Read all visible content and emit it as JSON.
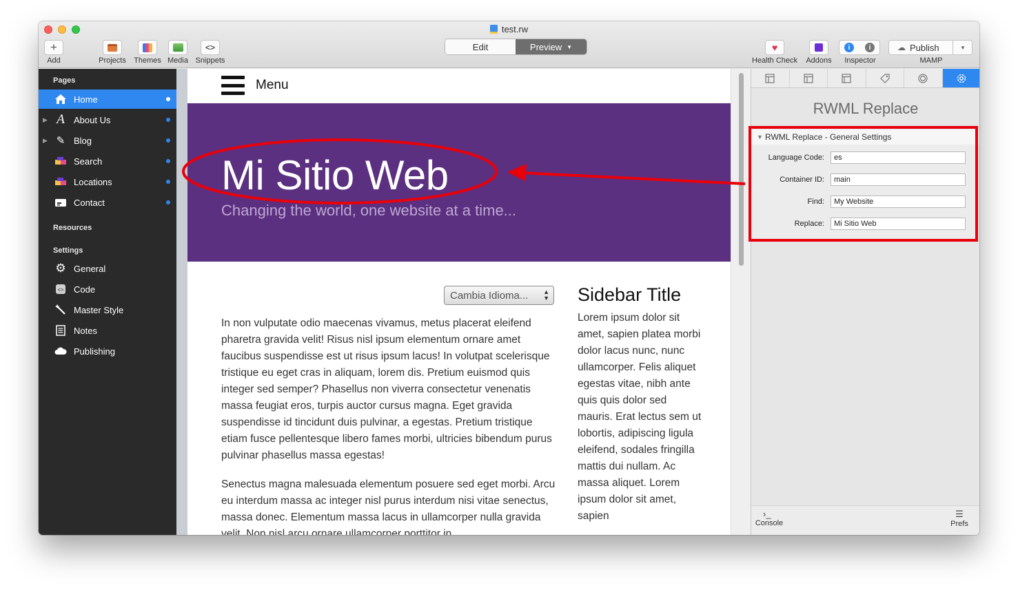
{
  "window": {
    "title": "test.rw"
  },
  "toolbar": {
    "add": "Add",
    "projects": "Projects",
    "themes": "Themes",
    "media": "Media",
    "snippets": "Snippets",
    "edit": "Edit",
    "preview": "Preview",
    "health_check": "Health Check",
    "addons": "Addons",
    "inspector": "Inspector",
    "publish": "Publish",
    "publish_target": "MAMP"
  },
  "sidebar": {
    "pages_header": "Pages",
    "pages": [
      {
        "label": "Home",
        "icon": "home-icon",
        "active": true
      },
      {
        "label": "About Us",
        "icon": "styled-text-icon"
      },
      {
        "label": "Blog",
        "icon": "pencil-icon"
      },
      {
        "label": "Search",
        "icon": "blocks-icon"
      },
      {
        "label": "Locations",
        "icon": "blocks-icon"
      },
      {
        "label": "Contact",
        "icon": "contact-card-icon"
      }
    ],
    "resources_header": "Resources",
    "settings_header": "Settings",
    "settings": [
      {
        "label": "General",
        "icon": "gear-icon"
      },
      {
        "label": "Code",
        "icon": "code-icon"
      },
      {
        "label": "Master Style",
        "icon": "wand-icon"
      },
      {
        "label": "Notes",
        "icon": "notes-icon"
      },
      {
        "label": "Publishing",
        "icon": "cloud-icon"
      }
    ]
  },
  "site": {
    "menu": "Menu",
    "title": "Mi Sitio Web",
    "subtitle": "Changing the world, one website at a time...",
    "language_select": "Cambia Idioma...",
    "paragraph1": "In non vulputate odio maecenas vivamus, metus placerat eleifend pharetra gravida velit! Risus nisl ipsum elementum ornare amet faucibus suspendisse est ut risus ipsum lacus! In volutpat scelerisque tristique eu eget cras in aliquam, lorem dis. Pretium euismod quis integer sed semper? Phasellus non viverra consectetur venenatis massa feugiat eros, turpis auctor cursus magna. Eget gravida suspendisse id tincidunt duis pulvinar, a egestas. Pretium tristique etiam fusce pellentesque libero fames morbi, ultricies bibendum purus pulvinar phasellus massa egestas!",
    "paragraph2": "Senectus magna malesuada elementum posuere sed eget morbi. Arcu eu interdum massa ac integer nisl purus interdum nisi vitae senectus, massa donec. Elementum massa lacus in ullamcorper nulla gravida velit. Non nisl arcu ornare ullamcorper porttitor in",
    "sidebar_title": "Sidebar Title",
    "sidebar_text": "Lorem ipsum dolor sit amet, sapien platea morbi dolor lacus nunc, nunc ullamcorper. Felis aliquet egestas vitae, nibh ante quis quis dolor sed mauris. Erat lectus sem ut lobortis, adipiscing ligula eleifend, sodales fringilla mattis dui nullam. Ac massa aliquet. Lorem ipsum dolor sit amet, sapien"
  },
  "inspector": {
    "title": "RWML Replace",
    "section": "RWML Replace - General Settings",
    "fields": [
      {
        "label": "Language Code:",
        "value": "es"
      },
      {
        "label": "Container ID:",
        "value": "main"
      },
      {
        "label": "Find:",
        "value": "My Website"
      },
      {
        "label": "Replace:",
        "value": "Mi Sitio Web"
      }
    ],
    "console": "Console",
    "prefs": "Prefs"
  },
  "colors": {
    "accent": "#2f88f0",
    "hero_bg": "#5c3080",
    "annotation": "#e8000b"
  }
}
